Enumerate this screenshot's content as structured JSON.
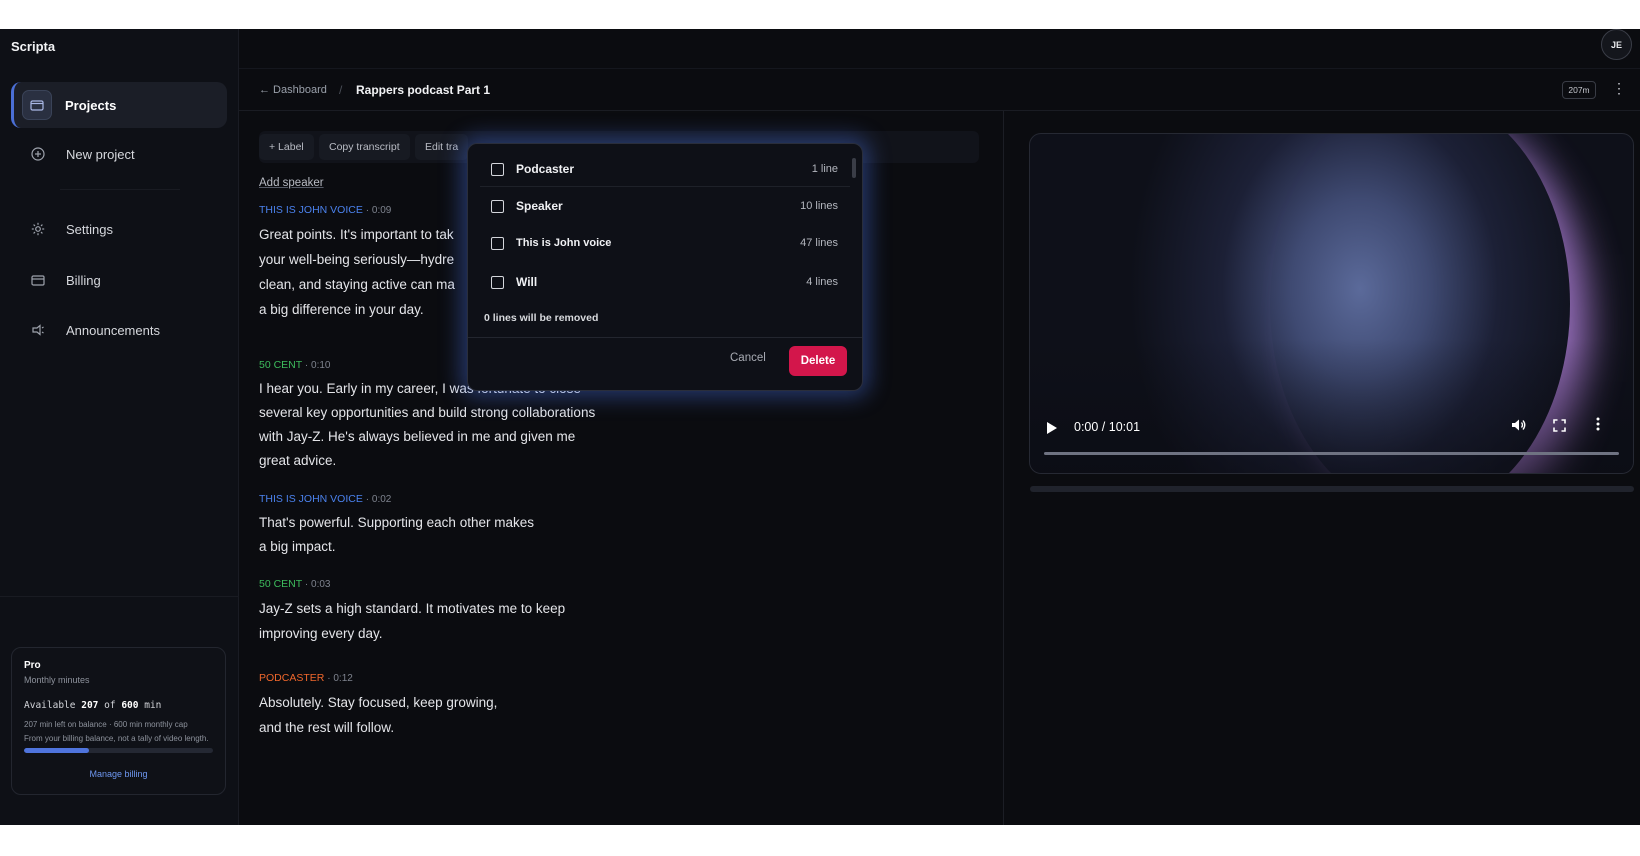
{
  "app": {
    "brand": "Scripta"
  },
  "sidebar": {
    "items": [
      {
        "label": "Projects"
      },
      {
        "label": "New project"
      },
      {
        "label": "Settings"
      },
      {
        "label": "Billing"
      },
      {
        "label": "Announcements"
      }
    ],
    "plan": {
      "name": "Pro",
      "subtitle": "Monthly minutes",
      "available_prefix": "Available",
      "available": "207",
      "of": "of",
      "cap": "600",
      "unit": "min",
      "balance_line": "207 min left on balance · 600 min monthly cap",
      "note": "From your billing balance, not a tally of video length.",
      "progress_fraction": 0.345,
      "manage_label": "Manage billing"
    }
  },
  "header": {
    "avatar_initials": "JE",
    "back_label": "← Dashboard",
    "separator": "/",
    "title": "Rappers podcast Part 1",
    "minutes_badge": "207m",
    "more_icon": "⋮"
  },
  "toolbar": {
    "label_button": "+ Label",
    "copy_button": "Copy transcript",
    "edit_button": "Edit tra"
  },
  "transcript": {
    "add_speaker": "Add speaker",
    "segments": [
      {
        "speaker": "THIS IS JOHN VOICE",
        "time": "· 0:09",
        "color": "#4b82ee",
        "lines": [
          "Great points. It's important to tak",
          "your well-being seriously—hydre",
          "clean, and staying active can ma",
          "a big difference in your day."
        ]
      },
      {
        "speaker": "50 CENT",
        "time": "· 0:10",
        "color": "#3dbb5c",
        "lines": [
          "I hear you. Early in my career, I was fortunate to close",
          "several key opportunities and build strong collaborations",
          "with Jay-Z. He's always believed in me and given me",
          "great advice."
        ]
      },
      {
        "speaker": "THIS IS JOHN VOICE",
        "time": "· 0:02",
        "color": "#4b82ee",
        "lines": [
          "That's powerful. Supporting each other makes",
          "a big impact."
        ]
      },
      {
        "speaker": "50 CENT",
        "time": "· 0:03",
        "color": "#3dbb5c",
        "lines": [
          "Jay-Z sets a high standard. It motivates me to keep",
          "improving every day."
        ]
      },
      {
        "speaker": "PODCASTER",
        "time": "· 0:12",
        "color": "#f0672c",
        "lines": [
          "Absolutely. Stay focused, keep growing,",
          "and the rest will follow."
        ]
      }
    ]
  },
  "video": {
    "time": "0:00 / 10:01"
  },
  "modal": {
    "options": [
      {
        "name": "Podcaster",
        "count": "1 line"
      },
      {
        "name": "Speaker",
        "count": "10 lines"
      },
      {
        "name": "This is John voice",
        "count": "47 lines"
      },
      {
        "name": "Will",
        "count": "4 lines"
      }
    ],
    "removal_note": "0 lines will be removed",
    "cancel_label": "Cancel",
    "delete_label": "Delete"
  }
}
